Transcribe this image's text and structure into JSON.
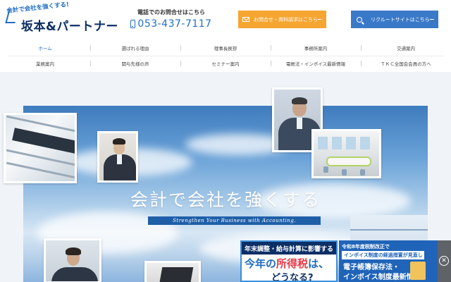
{
  "header": {
    "logo_tagline": "会計で会社を強くする!",
    "logo_name": "坂本&パートナー",
    "phone_caption": "電話でのお問合せはこちら",
    "phone_number": "053-437-7117",
    "contact_button": "お問合せ・資料請求はこちら",
    "recruit_button": "リクルートサイトはこちら"
  },
  "nav": {
    "row1": [
      "ホーム",
      "選ばれる理由",
      "理事長挨拶",
      "事務所案内",
      "交通案内"
    ],
    "row2": [
      "業務案内",
      "関与先様の声",
      "セミナー案内",
      "電帳法・インボイス最新情報",
      "ＴＫＣ全国会会員の方へ"
    ]
  },
  "hero": {
    "title": "会計で会社を強くする",
    "subtitle": "Strengthen Your Business with Accounting."
  },
  "banner_tax": {
    "top": "年末調整・給与計算に影響する",
    "main_prefix": "今年の",
    "main_accent": "所得税",
    "main_suffix": "は、",
    "sub": "どうなる?"
  },
  "banner_invoice": {
    "top": "令和8年度税制改正で",
    "tag": "インボイス制度の経過措置が見直し",
    "main1": "電子帳簿保存法・",
    "main2": "インボイス制度最新情報"
  },
  "colors": {
    "brand": "#1f6fc5",
    "navy": "#0c2f66",
    "contact_orange": "#f6a531",
    "recruit_blue": "#3a79c8"
  },
  "icons": [
    "mail-icon",
    "search-icon",
    "phone-icon",
    "close-icon"
  ]
}
